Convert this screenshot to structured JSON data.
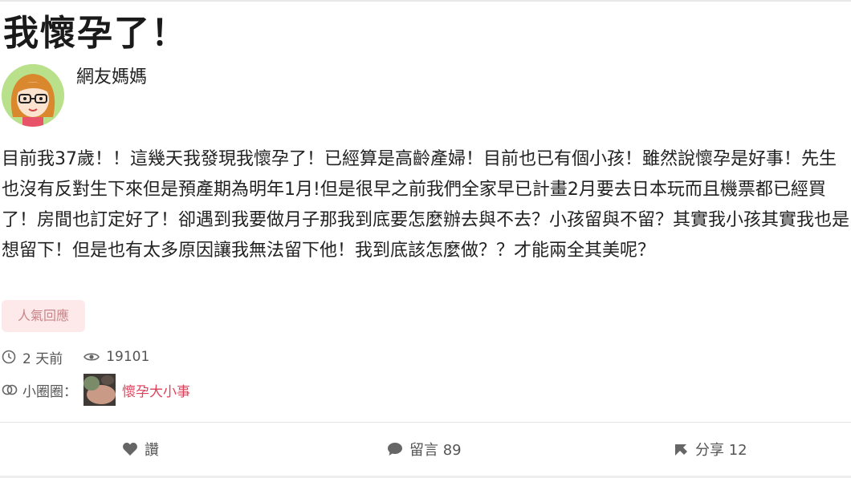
{
  "post": {
    "title": "我懷孕了！",
    "author": "網友媽媽",
    "body": "目前我37歲！！這幾天我發現我懷孕了！已經算是高齡產婦！目前也已有個小孩！雖然說懷孕是好事！先生也沒有反對生下來但是預產期為明年1月!但是很早之前我們全家早已計畫2月要去日本玩而且機票都已經買了！房間也訂定好了！卻遇到我要做月子那我到底要怎麼辦去與不去？小孩留與不留？其實我小孩其實我也是想留下！但是也有太多原因讓我無法留下他！我到底該怎麼做？？才能兩全其美呢？",
    "tag_label": "人氣回應",
    "time_ago": "2 天前",
    "views": "19101",
    "group_label": "小圈圈：",
    "group_name": "懷孕大小事"
  },
  "actions": {
    "like_label": "讚",
    "comment_label": "留言 89",
    "share_label": "分享 12"
  },
  "icons": {
    "clock": "clock-icon",
    "eye": "eye-icon",
    "group": "rings-icon",
    "heart": "heart-icon",
    "comment": "comment-bubble-icon",
    "share": "share-arrow-icon"
  },
  "colors": {
    "accent_pink": "#e0405a",
    "tag_bg": "#fde9ea",
    "avatar_bg": "#b9e08a"
  }
}
